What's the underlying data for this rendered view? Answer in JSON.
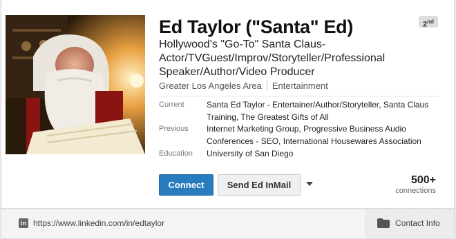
{
  "profile": {
    "name": "Ed Taylor (\"Santa\" Ed)",
    "degree": "2",
    "degree_suffix": "nd",
    "headline": "Hollywood's \"Go-To\" Santa Claus-Actor/TVGuest/Improv/Storyteller/Professional Speaker/Author/Video Producer",
    "location": "Greater Los Angeles Area",
    "industry": "Entertainment",
    "photo_icon": "profile-photo"
  },
  "details": {
    "current_label": "Current",
    "current_value": "Santa Ed Taylor - Entertainer/Author/Storyteller, Santa Claus Training, The Greatest Gifts of All",
    "previous_label": "Previous",
    "previous_value": "Internet Marketing Group, Progressive Business Audio Conferences - SEO, International Housewares Association",
    "education_label": "Education",
    "education_value": "University of San Diego"
  },
  "actions": {
    "connect_label": "Connect",
    "inmail_label": "Send Ed InMail"
  },
  "connections": {
    "count": "500+",
    "label": "connections"
  },
  "footer": {
    "url": "https://www.linkedin.com/in/edtaylor",
    "contact_label": "Contact Info",
    "linkedin_icon_text": "in"
  },
  "colors": {
    "connect_blue": "#287bbc",
    "badge_gray": "#dddddd"
  }
}
